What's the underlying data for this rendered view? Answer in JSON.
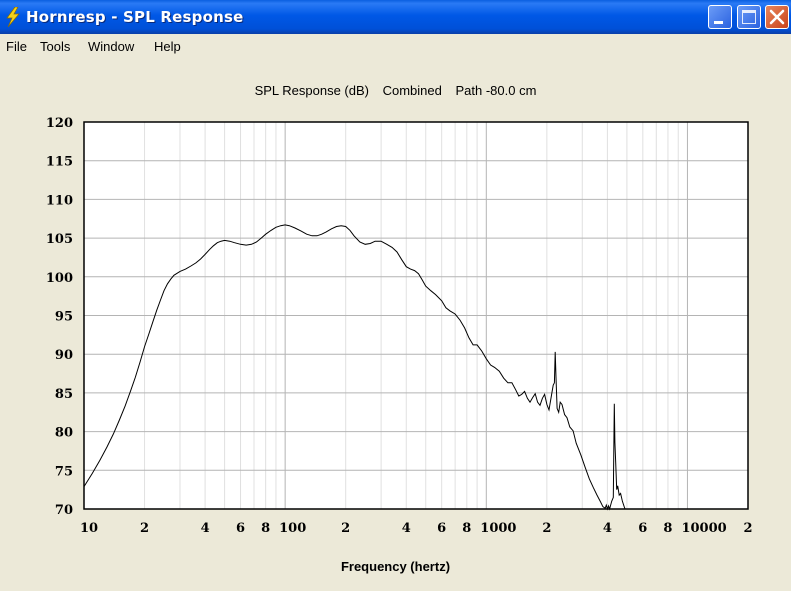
{
  "window": {
    "title": "Hornresp - SPL Response",
    "icon": "lightning-bolt-icon",
    "controls": [
      "minimize",
      "maximize",
      "close"
    ]
  },
  "menu": [
    {
      "label": "File"
    },
    {
      "label": "Tools"
    },
    {
      "label": "Window"
    },
    {
      "label": "Help"
    }
  ],
  "header": {
    "part1": "SPL Response (dB)",
    "part2": "Combined",
    "part3": "Path -80.0 cm"
  },
  "colors": {
    "grid_major": "#b4b4b4",
    "grid_minor": "#e0e0e0",
    "line": "#000000",
    "plot_bg": "#ffffff"
  },
  "chart_data": {
    "type": "line",
    "title": "SPL Response (dB)   Combined   Path -80.0 cm",
    "xlabel": "Frequency (hertz)",
    "ylabel": "",
    "xscale": "log",
    "xlim": [
      10,
      20000
    ],
    "ylim": [
      70,
      120
    ],
    "grid": true,
    "y_ticks": [
      120,
      115,
      110,
      105,
      100,
      95,
      90,
      85,
      80,
      75,
      70
    ],
    "x_ticks": [
      {
        "value": 10,
        "label": "10"
      },
      {
        "value": 20,
        "label": "2"
      },
      {
        "value": 40,
        "label": "4"
      },
      {
        "value": 60,
        "label": "6"
      },
      {
        "value": 80,
        "label": "8"
      },
      {
        "value": 100,
        "label": "100"
      },
      {
        "value": 200,
        "label": "2"
      },
      {
        "value": 400,
        "label": "4"
      },
      {
        "value": 600,
        "label": "6"
      },
      {
        "value": 800,
        "label": "8"
      },
      {
        "value": 1000,
        "label": "1000"
      },
      {
        "value": 2000,
        "label": "2"
      },
      {
        "value": 4000,
        "label": "4"
      },
      {
        "value": 6000,
        "label": "6"
      },
      {
        "value": 8000,
        "label": "8"
      },
      {
        "value": 10000,
        "label": "10000"
      },
      {
        "value": 20000,
        "label": "2"
      }
    ],
    "series": [
      {
        "name": "SPL Combined",
        "points": [
          [
            10,
            72.9
          ],
          [
            11,
            74.6
          ],
          [
            12,
            76.3
          ],
          [
            13,
            78.0
          ],
          [
            14,
            79.7
          ],
          [
            15,
            81.5
          ],
          [
            16,
            83.3
          ],
          [
            17,
            85.2
          ],
          [
            18,
            87.0
          ],
          [
            19,
            89.0
          ],
          [
            20,
            91.0
          ],
          [
            21,
            92.6
          ],
          [
            22,
            94.2
          ],
          [
            23,
            95.7
          ],
          [
            24,
            97.0
          ],
          [
            25,
            98.2
          ],
          [
            26,
            99.1
          ],
          [
            27,
            99.7
          ],
          [
            28,
            100.2
          ],
          [
            30,
            100.7
          ],
          [
            32,
            101.0
          ],
          [
            34,
            101.4
          ],
          [
            36,
            101.8
          ],
          [
            38,
            102.3
          ],
          [
            40,
            102.9
          ],
          [
            42,
            103.5
          ],
          [
            44,
            104.0
          ],
          [
            46,
            104.4
          ],
          [
            48,
            104.6
          ],
          [
            50,
            104.7
          ],
          [
            53,
            104.6
          ],
          [
            56,
            104.4
          ],
          [
            60,
            104.2
          ],
          [
            64,
            104.1
          ],
          [
            68,
            104.2
          ],
          [
            72,
            104.5
          ],
          [
            76,
            105.0
          ],
          [
            80,
            105.5
          ],
          [
            85,
            106.0
          ],
          [
            90,
            106.4
          ],
          [
            95,
            106.6
          ],
          [
            100,
            106.7
          ],
          [
            105,
            106.6
          ],
          [
            112,
            106.3
          ],
          [
            120,
            105.9
          ],
          [
            128,
            105.5
          ],
          [
            136,
            105.3
          ],
          [
            144,
            105.3
          ],
          [
            152,
            105.5
          ],
          [
            160,
            105.8
          ],
          [
            170,
            106.2
          ],
          [
            180,
            106.5
          ],
          [
            190,
            106.6
          ],
          [
            200,
            106.5
          ],
          [
            210,
            106.0
          ],
          [
            220,
            105.3
          ],
          [
            235,
            104.5
          ],
          [
            250,
            104.2
          ],
          [
            265,
            104.3
          ],
          [
            280,
            104.6
          ],
          [
            300,
            104.6
          ],
          [
            320,
            104.2
          ],
          [
            340,
            103.8
          ],
          [
            360,
            103.2
          ],
          [
            380,
            102.2
          ],
          [
            400,
            101.3
          ],
          [
            420,
            101.0
          ],
          [
            440,
            100.8
          ],
          [
            460,
            100.4
          ],
          [
            480,
            99.6
          ],
          [
            500,
            98.8
          ],
          [
            530,
            98.2
          ],
          [
            560,
            97.7
          ],
          [
            600,
            96.9
          ],
          [
            630,
            96.0
          ],
          [
            660,
            95.6
          ],
          [
            700,
            95.2
          ],
          [
            740,
            94.4
          ],
          [
            780,
            93.4
          ],
          [
            820,
            92.1
          ],
          [
            860,
            91.2
          ],
          [
            900,
            91.2
          ],
          [
            950,
            90.4
          ],
          [
            1000,
            89.4
          ],
          [
            1050,
            88.6
          ],
          [
            1100,
            88.3
          ],
          [
            1160,
            87.8
          ],
          [
            1220,
            86.9
          ],
          [
            1280,
            86.3
          ],
          [
            1340,
            86.3
          ],
          [
            1400,
            85.4
          ],
          [
            1450,
            84.6
          ],
          [
            1500,
            84.8
          ],
          [
            1550,
            85.2
          ],
          [
            1600,
            84.3
          ],
          [
            1650,
            83.8
          ],
          [
            1700,
            84.4
          ],
          [
            1750,
            84.9
          ],
          [
            1800,
            83.8
          ],
          [
            1850,
            83.4
          ],
          [
            1900,
            84.3
          ],
          [
            1950,
            84.8
          ],
          [
            2000,
            83.5
          ],
          [
            2050,
            82.8
          ],
          [
            2100,
            84.4
          ],
          [
            2150,
            86.0
          ],
          [
            2180,
            86.3
          ],
          [
            2200,
            90.3
          ],
          [
            2220,
            87.0
          ],
          [
            2250,
            83.0
          ],
          [
            2290,
            82.5
          ],
          [
            2330,
            83.8
          ],
          [
            2380,
            83.5
          ],
          [
            2450,
            82.2
          ],
          [
            2520,
            81.8
          ],
          [
            2600,
            80.6
          ],
          [
            2700,
            80.1
          ],
          [
            2800,
            78.5
          ],
          [
            2950,
            77.0
          ],
          [
            3100,
            75.4
          ],
          [
            3250,
            73.9
          ],
          [
            3400,
            72.8
          ],
          [
            3550,
            71.8
          ],
          [
            3700,
            70.9
          ],
          [
            3800,
            70.3
          ],
          [
            3900,
            70.1
          ],
          [
            3950,
            70.5
          ],
          [
            4000,
            70.0
          ],
          [
            4050,
            70.4
          ],
          [
            4100,
            70.0
          ],
          [
            4200,
            71.0
          ],
          [
            4280,
            71.5
          ],
          [
            4330,
            83.6
          ],
          [
            4360,
            78.6
          ],
          [
            4400,
            76.0
          ],
          [
            4450,
            72.5
          ],
          [
            4500,
            73.0
          ],
          [
            4580,
            71.8
          ],
          [
            4650,
            72.0
          ],
          [
            4750,
            71.0
          ],
          [
            4850,
            70.3
          ],
          [
            4900,
            70.0
          ]
        ]
      }
    ]
  },
  "axis": {
    "x_title": "Frequency (hertz)"
  }
}
